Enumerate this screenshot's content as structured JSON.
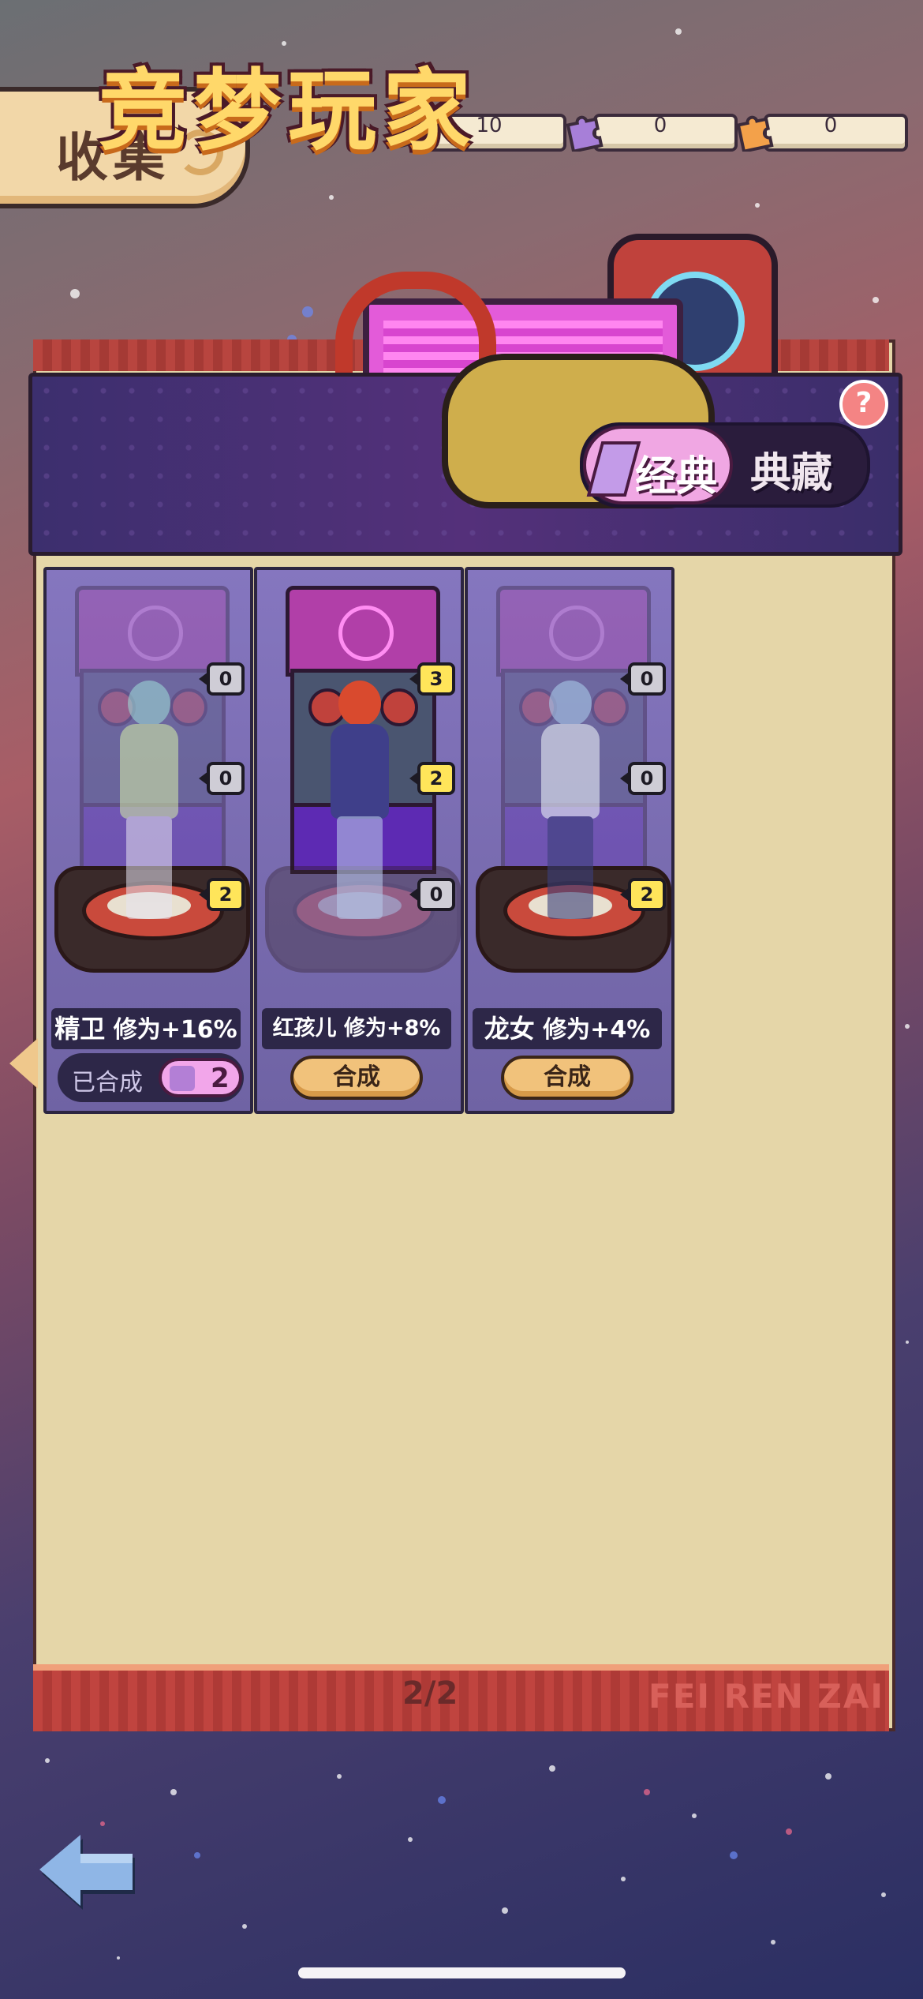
{
  "header": {
    "title": "收集"
  },
  "currencies": [
    {
      "icon": "ticket-icon",
      "value": "10",
      "color": "#c9a2ea"
    },
    {
      "icon": "purple-puzzle-icon",
      "value": "0",
      "color": "#a77fd8"
    },
    {
      "icon": "orange-puzzle-icon",
      "value": "0",
      "color": "#f3a14a"
    }
  ],
  "banner": {
    "title": "竞梦玩家",
    "tabs": {
      "active": "经典",
      "inactive": "典藏"
    },
    "help": "?"
  },
  "cards": [
    {
      "name": "精卫",
      "bonus": "修为+16%",
      "parts": [
        "0",
        "0",
        "2"
      ],
      "status": "已合成",
      "count": "2"
    },
    {
      "name": "红孩儿",
      "bonus": "修为+8%",
      "parts": [
        "3",
        "2",
        "0"
      ],
      "action": "合成"
    },
    {
      "name": "龙女",
      "bonus": "修为+4%",
      "parts": [
        "0",
        "0",
        "2"
      ],
      "action": "合成"
    }
  ],
  "pagination": {
    "page": "2/2"
  },
  "footer": {
    "watermark": "FEI REN ZAI"
  },
  "colors": {
    "accent": "#ffd86a",
    "book": "#e5d6a8",
    "card": "#7b6fb0"
  }
}
